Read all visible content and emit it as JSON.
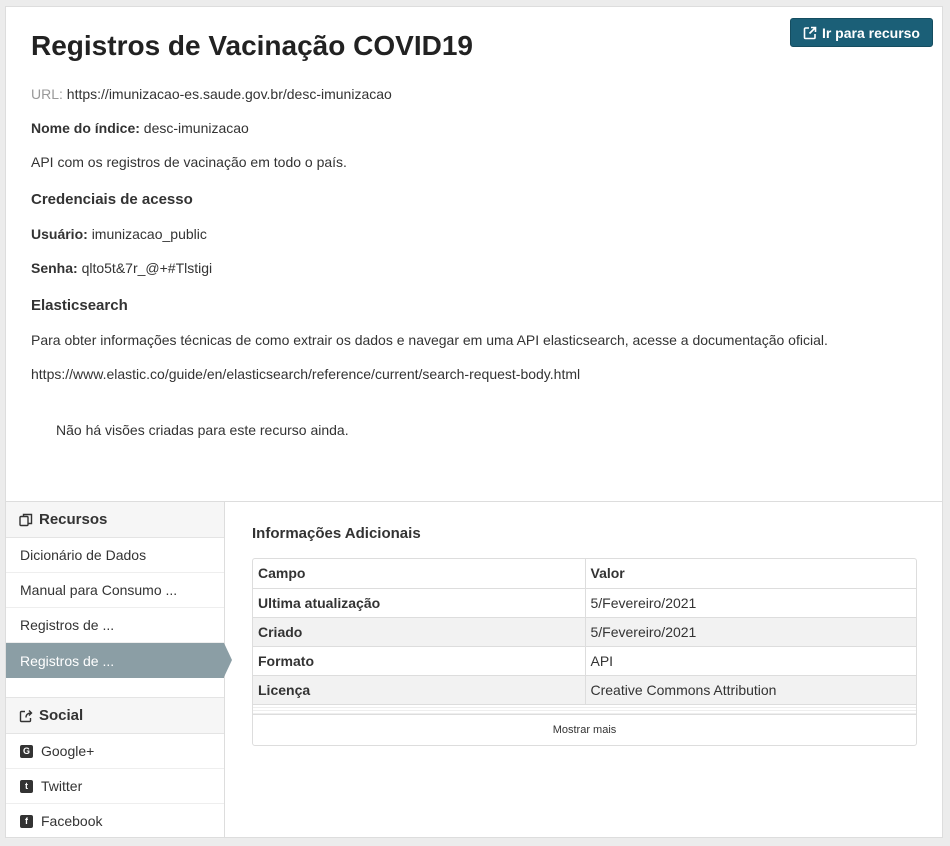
{
  "header": {
    "title": "Registros de Vacinação COVID19",
    "go_button_label": "Ir para recurso"
  },
  "details": {
    "url_label": "URL:",
    "url_value": "https://imunizacao-es.saude.gov.br/desc-imunizacao",
    "index_label": "Nome do índice:",
    "index_value": "desc-imunizacao",
    "description": "API com os registros de vacinação em todo o país."
  },
  "credentials": {
    "heading": "Credenciais de acesso",
    "user_label": "Usuário:",
    "user_value": "imunizacao_public",
    "password_label": "Senha:",
    "password_value": "qlto5t&7r_@+#Tlstigi"
  },
  "elastic": {
    "heading": "Elasticsearch",
    "text": "Para obter informações técnicas de como extrair os dados e navegar em uma API elasticsearch, acesse a documentação oficial.",
    "link": "https://www.elastic.co/guide/en/elasticsearch/reference/current/search-request-body.html"
  },
  "no_views": "Não há visões criadas para este recurso ainda.",
  "sidebar": {
    "resources_heading": "Recursos",
    "resources": [
      {
        "label": "Dicionário de Dados"
      },
      {
        "label": "Manual para Consumo ..."
      },
      {
        "label": "Registros de ..."
      },
      {
        "label": "Registros de ...",
        "active": true
      }
    ],
    "social_heading": "Social",
    "social": [
      {
        "label": "Google+",
        "icon": "google-plus-icon"
      },
      {
        "label": "Twitter",
        "icon": "twitter-icon"
      },
      {
        "label": "Facebook",
        "icon": "facebook-icon"
      }
    ]
  },
  "additional_info": {
    "heading": "Informações Adicionais",
    "columns": [
      "Campo",
      "Valor"
    ],
    "rows": [
      {
        "field": "Ultima atualização",
        "value": "5/Fevereiro/2021"
      },
      {
        "field": "Criado",
        "value": "5/Fevereiro/2021"
      },
      {
        "field": "Formato",
        "value": "API"
      },
      {
        "field": "Licença",
        "value": "Creative Commons Attribution"
      }
    ],
    "show_more": "Mostrar mais"
  },
  "colors": {
    "button": "#1b5f77",
    "active_item": "#8b9ea5"
  }
}
